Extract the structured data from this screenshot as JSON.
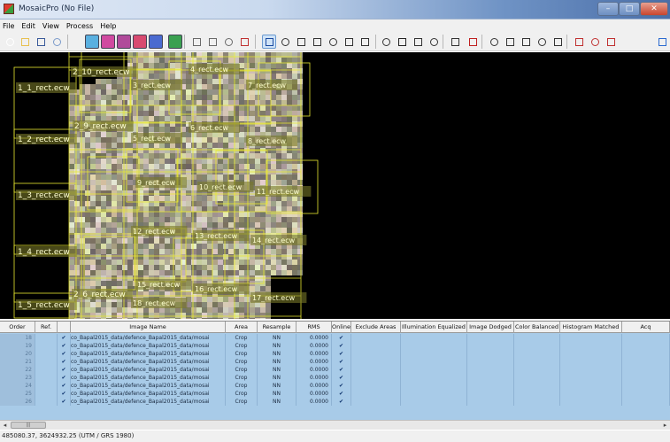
{
  "window": {
    "title": "MosaicPro (No File)"
  },
  "menu": [
    "File",
    "Edit",
    "View",
    "Process",
    "Help"
  ],
  "toolbar": {
    "icons": [
      {
        "name": "new-file-icon",
        "color": "#ffffff"
      },
      {
        "name": "open-folder-icon",
        "color": "#e8c050"
      },
      {
        "name": "save-icon",
        "color": "#3a5a9a"
      },
      {
        "name": "add-images-icon",
        "color": "#7a9aca"
      },
      {
        "name": "display-active-areas-icon",
        "color": "#5ab0e0"
      },
      {
        "name": "display-raster-images-icon",
        "color": "#d04aa0"
      },
      {
        "name": "display-outlines-icon",
        "color": "#b04a9a"
      },
      {
        "name": "display-exclude-areas-icon",
        "color": "#d84a70"
      },
      {
        "name": "show-grid-icon",
        "color": "#4a6ad0"
      },
      {
        "name": "color-corrections-icon",
        "color": "#3aa050"
      },
      {
        "name": "set-overlap-function-icon",
        "color": "#6a6a6a"
      },
      {
        "name": "seamline-icon",
        "color": "#6a6a6a"
      },
      {
        "name": "reference-icon",
        "color": "#6a6a6a"
      },
      {
        "name": "output-options-icon",
        "color": "#c03030"
      },
      {
        "name": "select-pointer-icon",
        "color": "#1a4aa0"
      },
      {
        "name": "select-box-icon",
        "color": "#333333"
      },
      {
        "name": "fit-extent-icon",
        "color": "#333333"
      },
      {
        "name": "zoom-box-icon",
        "color": "#333333"
      },
      {
        "name": "zoom-in-icon",
        "color": "#333333"
      },
      {
        "name": "zoom-out-icon",
        "color": "#333333"
      },
      {
        "name": "pan-hand-icon",
        "color": "#333333"
      },
      {
        "name": "image-properties-icon",
        "color": "#333333"
      },
      {
        "name": "color-balance-icon",
        "color": "#222222"
      },
      {
        "name": "histogram-icon",
        "color": "#333333"
      },
      {
        "name": "function-icon",
        "color": "#333333"
      },
      {
        "name": "seamline-editor-icon",
        "color": "#333333"
      },
      {
        "name": "run-mosaic-icon",
        "color": "#c02020"
      },
      {
        "name": "move-top-icon",
        "color": "#333333"
      },
      {
        "name": "move-up-icon",
        "color": "#333333"
      },
      {
        "name": "move-down-icon",
        "color": "#333333"
      },
      {
        "name": "move-bottom-icon",
        "color": "#333333"
      },
      {
        "name": "reverse-order-icon",
        "color": "#333333"
      },
      {
        "name": "cloud-icon",
        "color": "#c03030"
      },
      {
        "name": "cloud-remove-icon",
        "color": "#c03030"
      },
      {
        "name": "cloud-edit-icon",
        "color": "#c03030"
      },
      {
        "name": "help-icon",
        "color": "#2a6ad0"
      }
    ]
  },
  "viewport": {
    "row_labels": [
      "1_1_rect.ecw",
      "1_2_rect.ecw",
      "1_3_rect.ecw",
      "1_4_rect.ecw",
      "1_5_rect.ecw"
    ],
    "col_labels": [
      "2_10_rect.ecw",
      "2_9_rect.ecw",
      "2_6_rect.ecw"
    ],
    "inner_labels": [
      "3_rect.ecw",
      "4_rect.ecw",
      "5_rect.ecw",
      "6_rect.ecw",
      "7_rect.ecw",
      "8_rect.ecw",
      "9_rect.ecw",
      "10_rect.ecw",
      "11_rect.ecw",
      "12_rect.ecw",
      "13_rect.ecw",
      "14_rect.ecw",
      "15_rect.ecw",
      "16_rect.ecw",
      "17_rect.ecw",
      "18_rect.ecw"
    ]
  },
  "table": {
    "columns": [
      "Order",
      "Ref.",
      "",
      "Image Name",
      "Area",
      "Resample",
      "RMS",
      "Online",
      "Exclude Areas",
      "Illumination Equalized",
      "Image Dodged",
      "Color Balanced",
      "Histogram Matched",
      "Acq"
    ],
    "rows": [
      {
        "order": "18",
        "ref": "",
        "vis": "✔",
        "name": "co_Bapal2015_data/defence_Bapal2015_data/mosai",
        "area": "Crop",
        "resample": "NN",
        "rms": "0.0000",
        "online": "✔"
      },
      {
        "order": "19",
        "ref": "",
        "vis": "✔",
        "name": "co_Bapal2015_data/defence_Bapal2015_data/mosai",
        "area": "Crop",
        "resample": "NN",
        "rms": "0.0000",
        "online": "✔"
      },
      {
        "order": "20",
        "ref": "",
        "vis": "✔",
        "name": "co_Bapal2015_data/defence_Bapal2015_data/mosai",
        "area": "Crop",
        "resample": "NN",
        "rms": "0.0000",
        "online": "✔"
      },
      {
        "order": "21",
        "ref": "",
        "vis": "✔",
        "name": "co_Bapal2015_data/defence_Bapal2015_data/mosai",
        "area": "Crop",
        "resample": "NN",
        "rms": "0.0000",
        "online": "✔"
      },
      {
        "order": "22",
        "ref": "",
        "vis": "✔",
        "name": "co_Bapal2015_data/defence_Bapal2015_data/mosai",
        "area": "Crop",
        "resample": "NN",
        "rms": "0.0000",
        "online": "✔"
      },
      {
        "order": "23",
        "ref": "",
        "vis": "✔",
        "name": "co_Bapal2015_data/defence_Bapal2015_data/mosai",
        "area": "Crop",
        "resample": "NN",
        "rms": "0.0000",
        "online": "✔"
      },
      {
        "order": "24",
        "ref": "",
        "vis": "✔",
        "name": "co_Bapal2015_data/defence_Bapal2015_data/mosai",
        "area": "Crop",
        "resample": "NN",
        "rms": "0.0000",
        "online": "✔"
      },
      {
        "order": "25",
        "ref": "",
        "vis": "✔",
        "name": "co_Bapal2015_data/defence_Bapal2015_data/mosai",
        "area": "Crop",
        "resample": "NN",
        "rms": "0.0000",
        "online": "✔"
      },
      {
        "order": "26",
        "ref": "",
        "vis": "✔",
        "name": "co_Bapal2015_data/defence_Bapal2015_data/mosai",
        "area": "Crop",
        "resample": "NN",
        "rms": "0.0000",
        "online": "✔"
      }
    ]
  },
  "status": {
    "coords": "485080.37, 3624932.25  (UTM / GRS 1980)"
  },
  "colors": {
    "table_bg": "#a8cbe8",
    "tile_outline": "#e8e830",
    "viewport_bg": "#000000"
  }
}
